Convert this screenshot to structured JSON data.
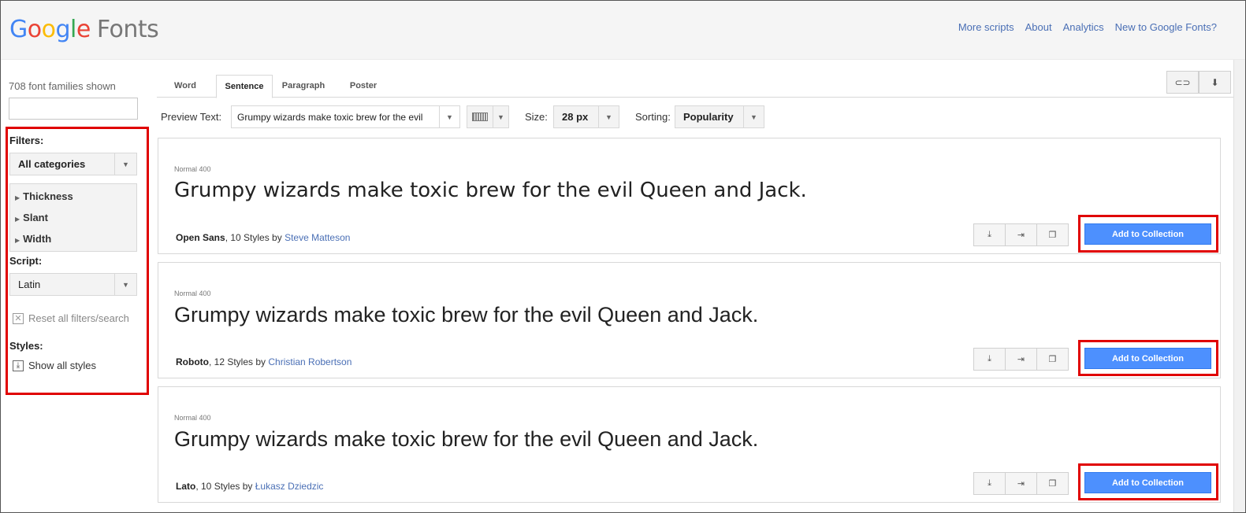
{
  "header": {
    "logo_google": [
      "G",
      "o",
      "o",
      "g",
      "l",
      "e"
    ],
    "logo_fonts": "Fonts",
    "links": [
      "More scripts",
      "About",
      "Analytics",
      "New to Google Fonts?"
    ]
  },
  "sidebar": {
    "count_text": "708 font families shown",
    "search_value": "",
    "filters_label": "Filters:",
    "category_value": "All categories",
    "accordion": [
      "Thickness",
      "Slant",
      "Width"
    ],
    "script_label": "Script:",
    "script_value": "Latin",
    "reset_label": "Reset all filters/search",
    "styles_label": "Styles:",
    "show_all_label": "Show all styles"
  },
  "tabs": [
    {
      "label": "Word",
      "active": false
    },
    {
      "label": "Sentence",
      "active": true
    },
    {
      "label": "Paragraph",
      "active": false
    },
    {
      "label": "Poster",
      "active": false
    }
  ],
  "controls": {
    "preview_label": "Preview Text:",
    "preview_value": "Grumpy wizards make toxic brew for the evil",
    "size_label": "Size:",
    "size_value": "28 px",
    "sorting_label": "Sorting:",
    "sorting_value": "Popularity"
  },
  "fonts": [
    {
      "weight": "Normal 400",
      "sample": "Grumpy wizards make toxic brew for the evil Queen and Jack.",
      "name": "Open Sans",
      "styles": ", 10 Styles by ",
      "author": "Steve Matteson",
      "button": "Add to Collection"
    },
    {
      "weight": "Normal 400",
      "sample": "Grumpy wizards make toxic brew for the evil Queen and Jack.",
      "name": "Roboto",
      "styles": ", 12 Styles by ",
      "author": "Christian Robertson",
      "button": "Add to Collection"
    },
    {
      "weight": "Normal 400",
      "sample": "Grumpy wizards make toxic brew for the evil Queen and Jack.",
      "name": "Lato",
      "styles": ", 10 Styles by ",
      "author": "Łukasz Dziedzic",
      "button": "Add to Collection"
    }
  ],
  "colors": {
    "accent": "#4d90fe",
    "link": "#4a6fb5",
    "highlight": "#e00000"
  }
}
